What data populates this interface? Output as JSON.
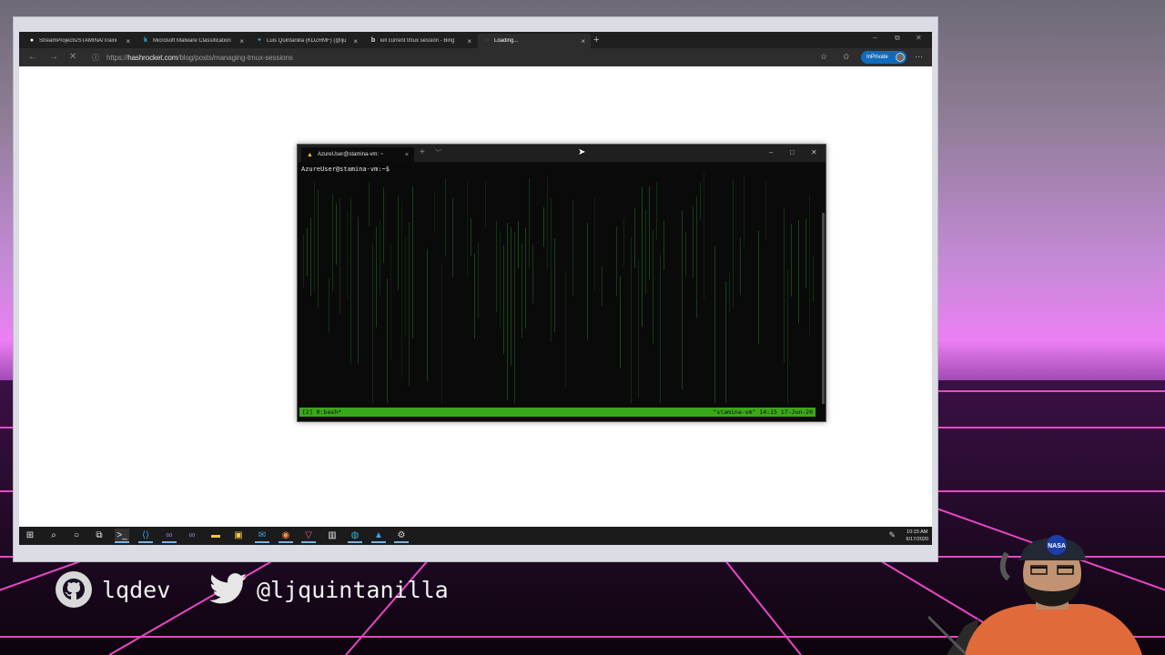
{
  "browser": {
    "tabs": [
      {
        "icon": "github-icon",
        "label": "StreamProjects/STAMINA/Traini",
        "active": false
      },
      {
        "icon": "kaggle-icon",
        "label": "Microsoft Malware Classification",
        "active": false
      },
      {
        "icon": "twitter-icon",
        "label": "Luis Quintanilla (KDZRMF) (@lju",
        "active": false
      },
      {
        "icon": "bing-icon",
        "label": "kill current tmux session - Bing",
        "active": false
      },
      {
        "icon": "loading-icon",
        "label": "Loading...",
        "active": true
      }
    ],
    "url_prefix": "https://",
    "url_host": "hashrocket.com",
    "url_path": "/blog/posts/managing-tmux-sessions",
    "inprivate_label": "InPrivate"
  },
  "terminal": {
    "tab_title": "AzureUser@stamina-vm: ~",
    "prompt": "AzureUser@stamina-vm:~$",
    "status_left": "[2] 0:bash*",
    "status_right": "\"stamina-vm\" 14:15 17-Jun-20"
  },
  "taskbar": {
    "time": "10:15 AM",
    "date": "6/17/2020"
  },
  "overlay": {
    "github_handle": "lqdev",
    "twitter_handle": "@ljquintanilla",
    "cap_text": "NASA"
  },
  "colors": {
    "tmux_status": "#3aa81a",
    "matrix_green": "#1d5a1d",
    "neon_pink": "#ff4fd8",
    "inprivate_blue": "#0f6cbd"
  }
}
